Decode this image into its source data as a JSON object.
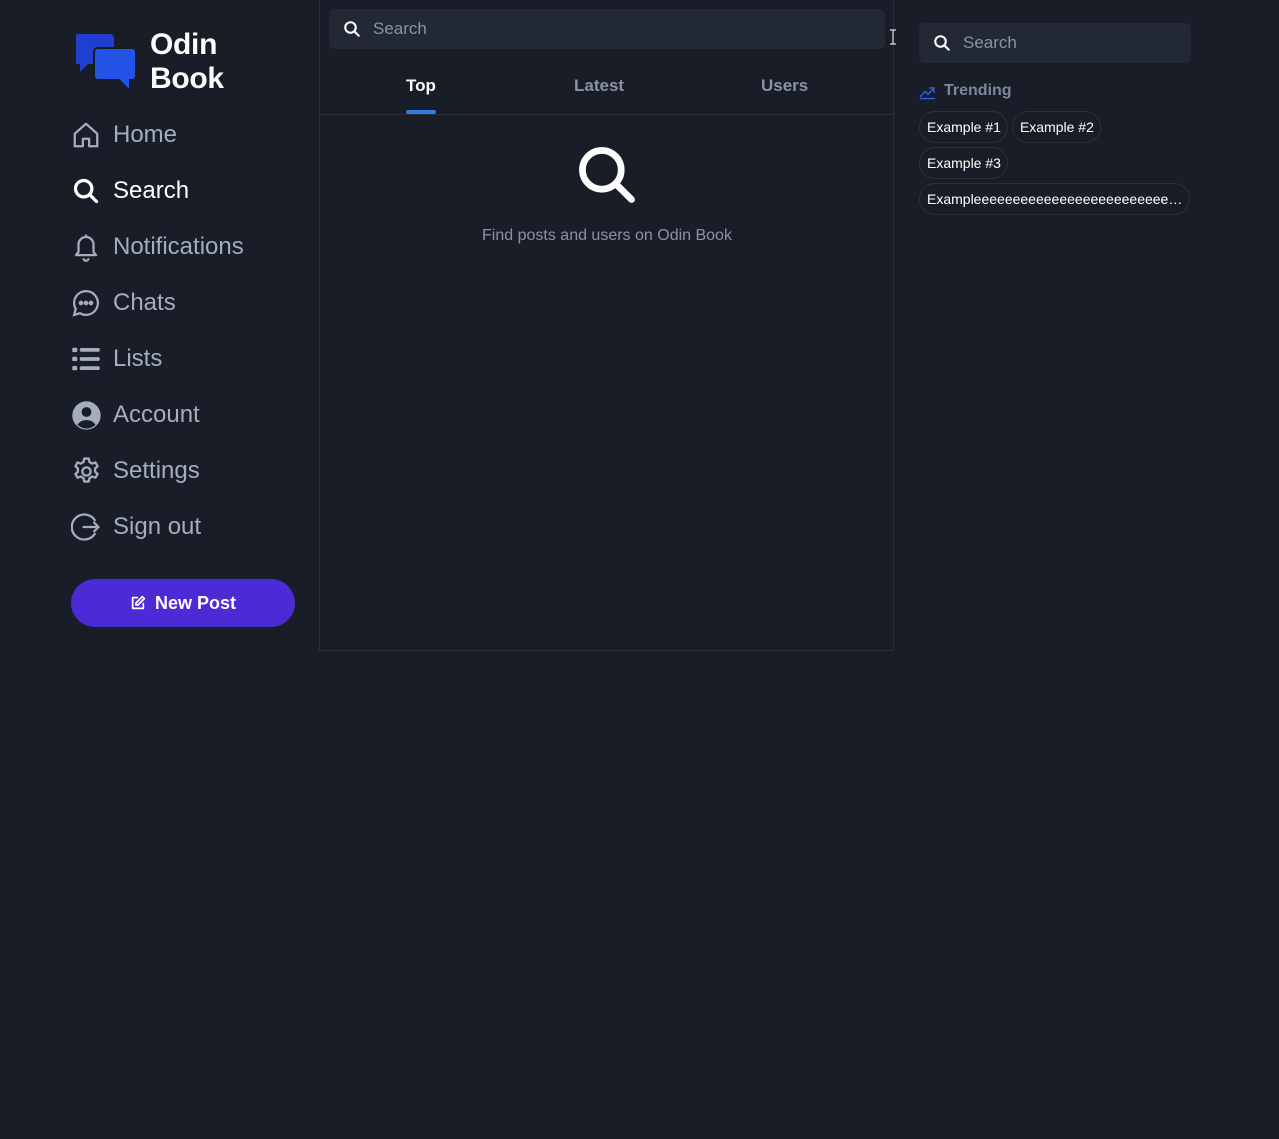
{
  "app": {
    "name": "Odin Book"
  },
  "sidebar": {
    "items": [
      {
        "label": "Home",
        "icon": "home-icon"
      },
      {
        "label": "Search",
        "icon": "search-icon"
      },
      {
        "label": "Notifications",
        "icon": "bell-icon"
      },
      {
        "label": "Chats",
        "icon": "chat-bubble-icon"
      },
      {
        "label": "Lists",
        "icon": "list-icon"
      },
      {
        "label": "Account",
        "icon": "user-circle-icon"
      },
      {
        "label": "Settings",
        "icon": "gear-icon"
      },
      {
        "label": "Sign out",
        "icon": "sign-out-icon"
      }
    ],
    "active_item": "Search",
    "new_post_label": "New Post"
  },
  "main": {
    "search_placeholder": "Search",
    "tabs": [
      {
        "label": "Top"
      },
      {
        "label": "Latest"
      },
      {
        "label": "Users"
      }
    ],
    "active_tab": "Top",
    "empty_message": "Find posts and users on Odin Book"
  },
  "right": {
    "search_placeholder": "Search",
    "trending_label": "Trending",
    "trending_tags": [
      "Example #1",
      "Example #2",
      "Example #3",
      "Exampleeeeeeeeeeeeeeeeeeeeeeeeeeeeeeeeeee"
    ]
  },
  "colors": {
    "background": "#191d27",
    "accent": "#4a2bd6",
    "tab_underline": "#2f7de0",
    "logo_blue": "#1e40d6"
  }
}
